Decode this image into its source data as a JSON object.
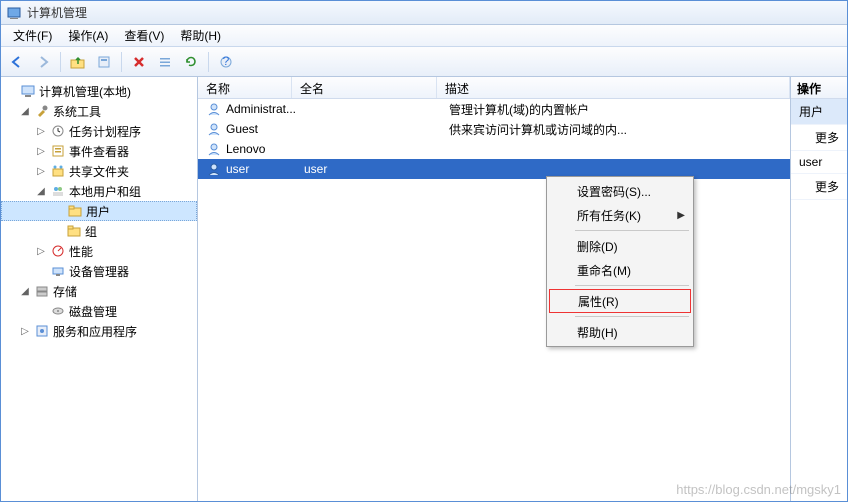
{
  "window": {
    "title": "计算机管理"
  },
  "menu": {
    "items": [
      "文件(F)",
      "操作(A)",
      "查看(V)",
      "帮助(H)"
    ]
  },
  "tree": {
    "root": "计算机管理(本地)",
    "nodes": [
      {
        "label": "系统工具",
        "expander": "▢"
      },
      {
        "label": "任务计划程序",
        "expander": "▷",
        "indent": 2
      },
      {
        "label": "事件查看器",
        "expander": "▷",
        "indent": 2
      },
      {
        "label": "共享文件夹",
        "expander": "▷",
        "indent": 2
      },
      {
        "label": "本地用户和组",
        "expander": "▢",
        "indent": 2
      },
      {
        "label": "用户",
        "indent": 3,
        "selected": true
      },
      {
        "label": "组",
        "indent": 3
      },
      {
        "label": "性能",
        "expander": "▷",
        "indent": 2
      },
      {
        "label": "设备管理器",
        "indent": 2
      },
      {
        "label": "存储",
        "expander": "▢"
      },
      {
        "label": "磁盘管理",
        "indent": 2
      },
      {
        "label": "服务和应用程序",
        "expander": "▷"
      }
    ]
  },
  "list": {
    "columns": {
      "name": "名称",
      "fullname": "全名",
      "description": "描述"
    },
    "colwidths": {
      "name": 94,
      "fullname": 145,
      "description": 200
    },
    "rows": [
      {
        "name": "Administrat...",
        "fullname": "",
        "description": "管理计算机(域)的内置帐户"
      },
      {
        "name": "Guest",
        "fullname": "",
        "description": "供来宾访问计算机或访问域的内..."
      },
      {
        "name": "Lenovo",
        "fullname": "",
        "description": ""
      },
      {
        "name": "user",
        "fullname": "user",
        "description": "",
        "selected": true
      }
    ]
  },
  "actions": {
    "header": "操作",
    "items": [
      {
        "label": "用户",
        "hl": true
      },
      {
        "label": "更多"
      },
      {
        "label": "user"
      },
      {
        "label": "更多"
      }
    ]
  },
  "context_menu": {
    "items": [
      {
        "label": "设置密码(S)..."
      },
      {
        "label": "所有任务(K)",
        "submenu": true
      },
      {
        "sep": true
      },
      {
        "label": "删除(D)"
      },
      {
        "label": "重命名(M)"
      },
      {
        "sep": true
      },
      {
        "label": "属性(R)",
        "highlight": true
      },
      {
        "sep": true
      },
      {
        "label": "帮助(H)"
      }
    ]
  },
  "watermark": "https://blog.csdn.net/mgsky1"
}
